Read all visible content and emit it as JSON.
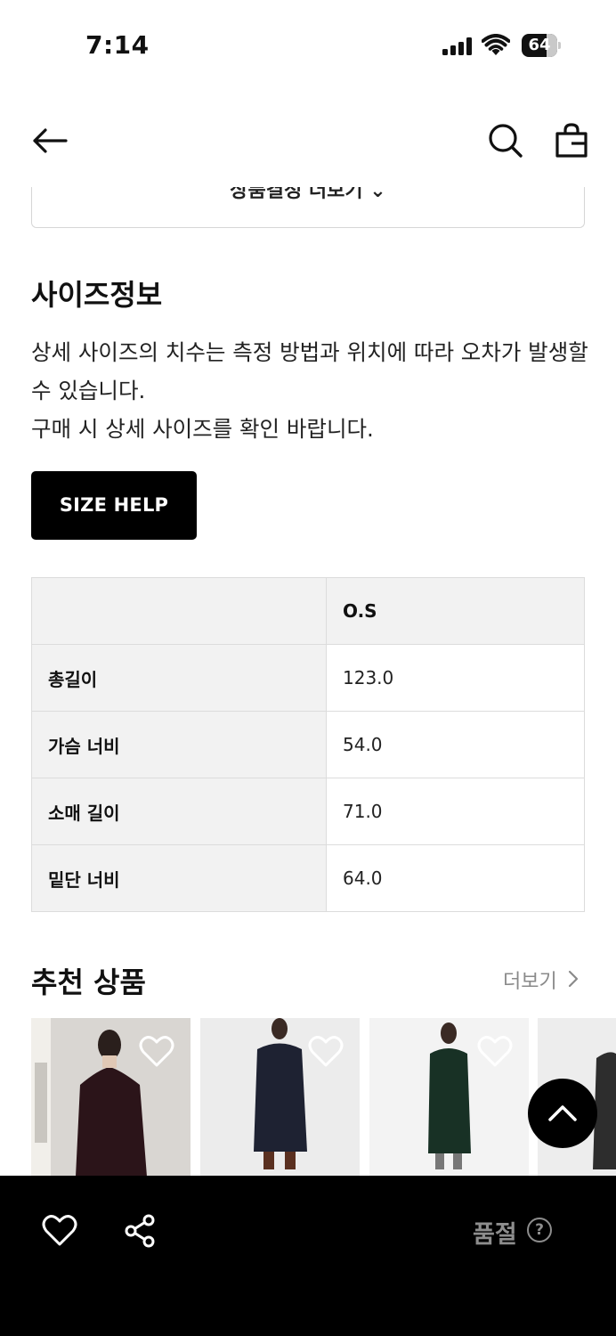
{
  "status_bar": {
    "time": "7:14",
    "battery": "64"
  },
  "nav": {
    "back_icon": "arrow-left-icon",
    "search_icon": "search-icon",
    "bag_icon": "shopping-bag-icon"
  },
  "details_toggle": {
    "label": "상품결정 더보기 ⌄"
  },
  "size_info": {
    "title": "사이즈정보",
    "notice_line1": "상세 사이즈의 치수는 측정 방법과 위치에 따라 오차가 발생할 수 있습니다.",
    "notice_line2": "구매 시 상세 사이즈를 확인 바랍니다.",
    "size_help_label": "SIZE HELP",
    "table": {
      "size_header": "O.S",
      "rows": [
        {
          "label": "총길이",
          "value": "123.0"
        },
        {
          "label": "가슴 너비",
          "value": "54.0"
        },
        {
          "label": "소매 길이",
          "value": "71.0"
        },
        {
          "label": "밑단 너비",
          "value": "64.0"
        }
      ]
    }
  },
  "recommended": {
    "title": "추천 상품",
    "more_label": "더보기"
  },
  "bottom_bar": {
    "soldout_label": "품절",
    "help_symbol": "?"
  },
  "colors": {
    "accent": "#000000",
    "muted": "#8d8d8d",
    "table_header_bg": "#f2f2f2"
  }
}
